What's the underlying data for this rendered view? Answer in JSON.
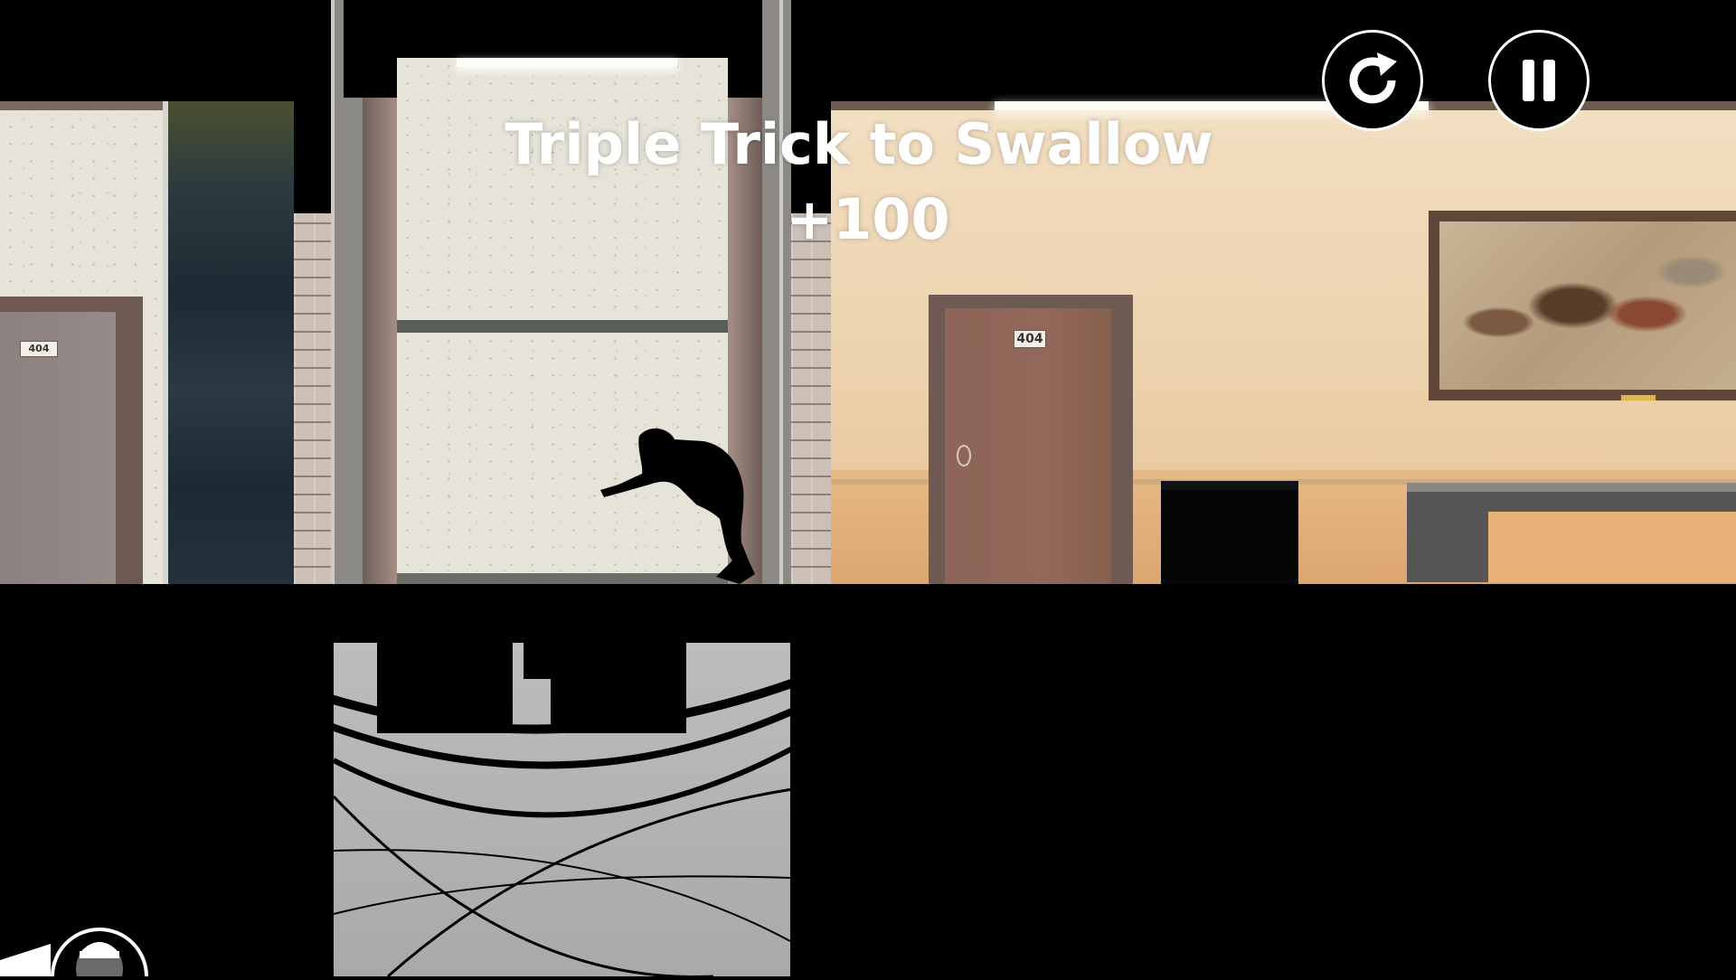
{
  "hud": {
    "restart_icon": "restart-icon",
    "pause_icon": "pause-icon",
    "avatar_icon": "player-avatar-icon"
  },
  "trick_popup": {
    "title": "Triple Trick to Swallow",
    "points": "+100"
  },
  "scene": {
    "door_numbers": [
      "404",
      "404"
    ]
  },
  "colors": {
    "hud_white": "#ffffff",
    "silhouette": "#000000",
    "warm_wall": "#ecd2ad",
    "cool_wall": "#e6e4d8"
  }
}
